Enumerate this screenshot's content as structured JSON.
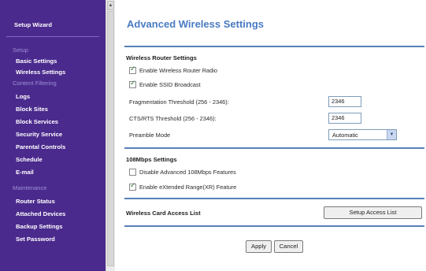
{
  "sidebar": {
    "items": [
      {
        "label": "Setup Wizard",
        "type": "link"
      },
      {
        "label": "Setup",
        "type": "header"
      },
      {
        "label": "Basic Settings",
        "type": "link"
      },
      {
        "label": "Wireless Settings",
        "type": "link"
      },
      {
        "label": "Content Filtering",
        "type": "header"
      },
      {
        "label": "Logs",
        "type": "link"
      },
      {
        "label": "Block Sites",
        "type": "link"
      },
      {
        "label": "Block Services",
        "type": "link"
      },
      {
        "label": "Security Service",
        "type": "link"
      },
      {
        "label": "Parental Controls",
        "type": "link"
      },
      {
        "label": "Schedule",
        "type": "link"
      },
      {
        "label": "E-mail",
        "type": "link"
      },
      {
        "label": "Maintenance",
        "type": "header"
      },
      {
        "label": "Router Status",
        "type": "link"
      },
      {
        "label": "Attached Devices",
        "type": "link"
      },
      {
        "label": "Backup Settings",
        "type": "link"
      },
      {
        "label": "Set Password",
        "type": "link"
      }
    ]
  },
  "main": {
    "title": "Advanced Wireless Settings",
    "router_settings": {
      "heading": "Wireless Router Settings",
      "enable_radio": {
        "label": "Enable Wireless Router Radio",
        "checked": true
      },
      "enable_ssid": {
        "label": "Enable SSID Broadcast",
        "checked": true
      },
      "frag_threshold": {
        "label": "Fragmentation Threshold (256 - 2346):",
        "value": "2346"
      },
      "cts_threshold": {
        "label": "CTS/RTS Threshold (256 - 2346):",
        "value": "2346"
      },
      "preamble": {
        "label": "Preamble Mode",
        "value": "Automatic"
      }
    },
    "mbps_settings": {
      "heading": "108Mbps Settings",
      "disable_108": {
        "label": "Disable Advanced 108Mbps Features",
        "checked": false
      },
      "extended_range": {
        "label": "Enable eXtended Range(XR) Feature",
        "checked": true
      }
    },
    "access_list": {
      "label": "Wireless Card Access List",
      "button": "Setup Access List"
    },
    "actions": {
      "apply": "Apply",
      "cancel": "Cancel"
    }
  },
  "colors": {
    "sidebar_bg": "#4b2a8d",
    "sidebar_header": "#9f8fd6",
    "title": "#4a7bc3",
    "rule": "#5a7fb8"
  }
}
